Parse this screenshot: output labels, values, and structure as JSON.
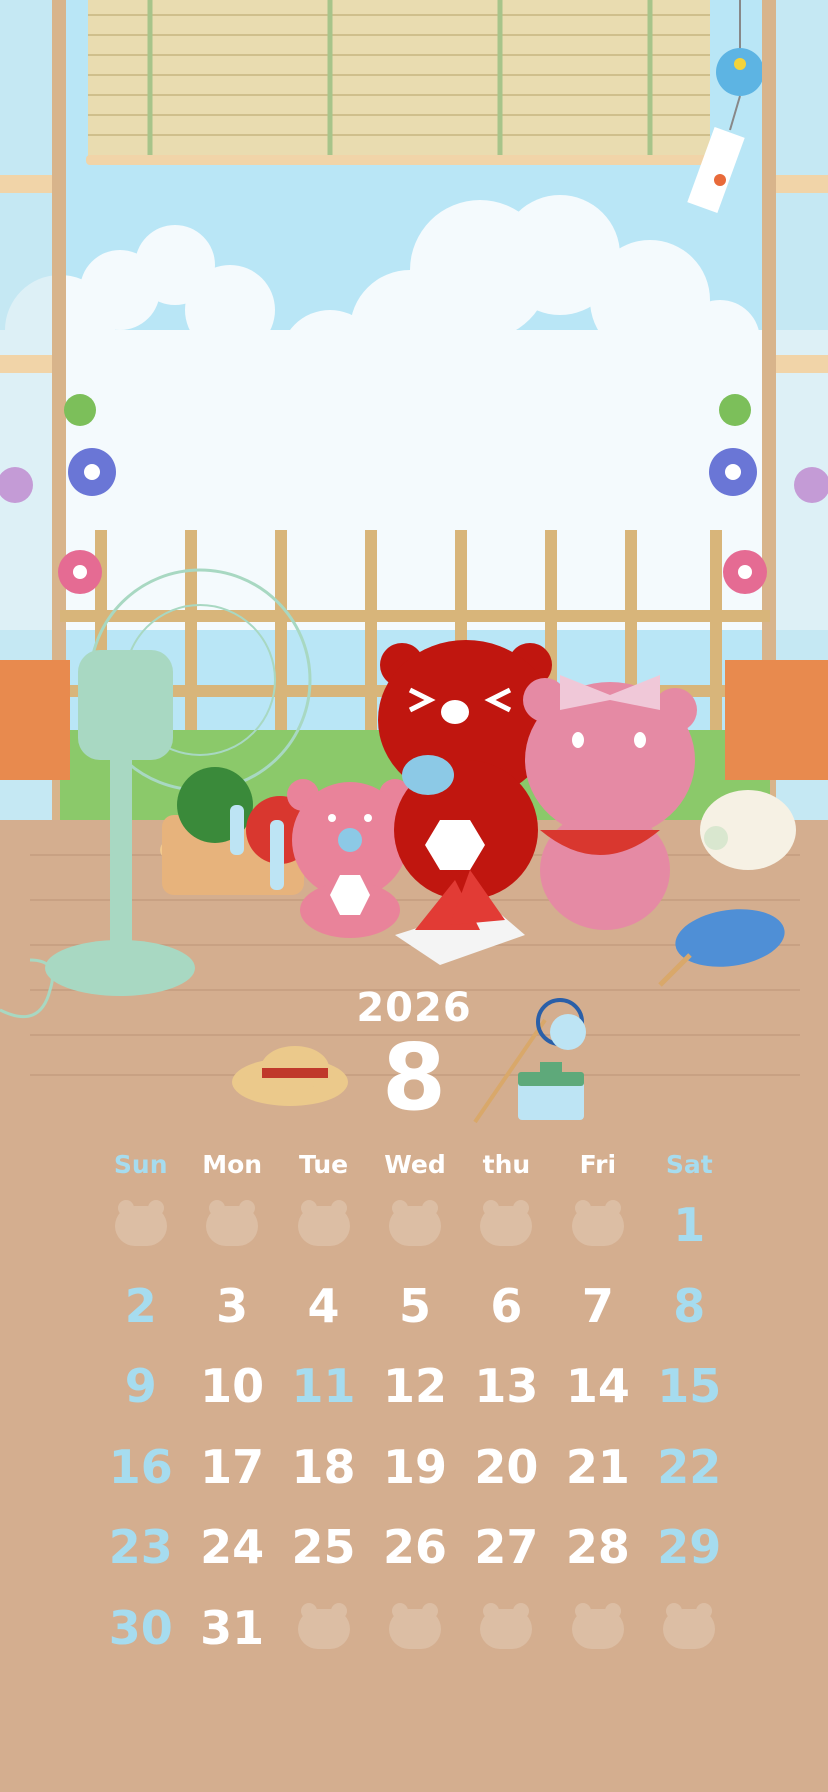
{
  "calendar": {
    "year": "2026",
    "month": "8",
    "weekdays": [
      {
        "label": "Sun",
        "color": "#a6dcef"
      },
      {
        "label": "Mon",
        "color": "#ffffff"
      },
      {
        "label": "Tue",
        "color": "#ffffff"
      },
      {
        "label": "Wed",
        "color": "#ffffff"
      },
      {
        "label": "thu",
        "color": "#ffffff"
      },
      {
        "label": "Fri",
        "color": "#ffffff"
      },
      {
        "label": "Sat",
        "color": "#a6dcef"
      }
    ],
    "weeks": [
      [
        null,
        null,
        null,
        null,
        null,
        null,
        "1"
      ],
      [
        "2",
        "3",
        "4",
        "5",
        "6",
        "7",
        "8"
      ],
      [
        "9",
        "10",
        "11",
        "12",
        "13",
        "14",
        "15"
      ],
      [
        "16",
        "17",
        "18",
        "19",
        "20",
        "21",
        "22"
      ],
      [
        "23",
        "24",
        "25",
        "26",
        "27",
        "28",
        "29"
      ],
      [
        "30",
        "31",
        null,
        null,
        null,
        null,
        null
      ]
    ],
    "holidays": [
      "11"
    ]
  },
  "colors": {
    "floor": "#d4ae8f",
    "sky": "#b9e6f6",
    "weekend_blue": "#a6dcef",
    "bear_red": "#c0160f",
    "bear_pink": "#e9839a",
    "fan_green": "#a8d8c2"
  },
  "icons": [
    "window-blind",
    "wind-chime",
    "morning-glory",
    "electric-fan",
    "watermelon",
    "ramune-bottle",
    "shaved-ice",
    "uchiwa-fan",
    "mosquito-pig",
    "straw-hat",
    "bug-net",
    "bug-cage"
  ]
}
